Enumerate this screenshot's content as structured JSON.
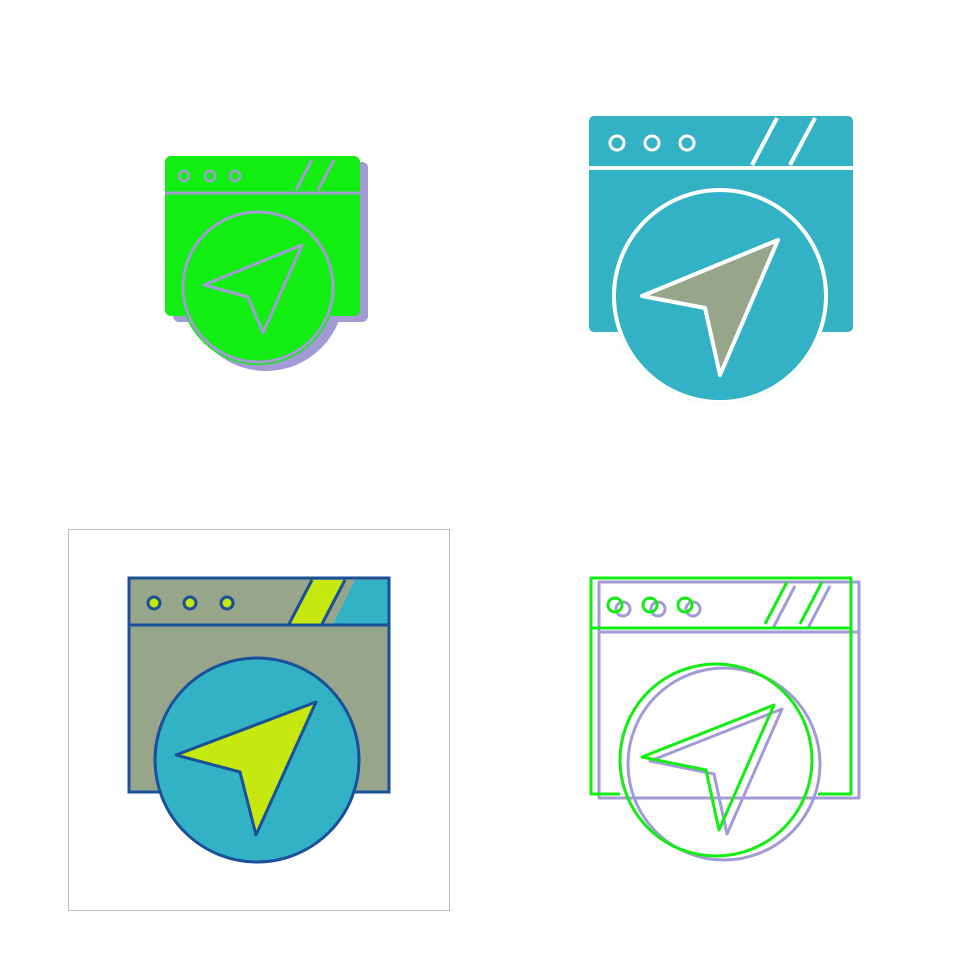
{
  "icons": [
    {
      "variant": "glyph",
      "name": "browser-navigation-icon"
    },
    {
      "variant": "solid",
      "name": "browser-navigation-icon"
    },
    {
      "variant": "filled-outline",
      "name": "browser-navigation-icon"
    },
    {
      "variant": "line",
      "name": "browser-navigation-icon"
    }
  ],
  "colors": {
    "green": "#12ee12",
    "lavender": "#a39bd6",
    "teal": "#33b2c6",
    "gray_green": "#97a58a",
    "dark_blue": "#1a4f9a",
    "lime": "#c6e80e",
    "white": "#ffffff",
    "frame_border": "#bdbdbd"
  }
}
